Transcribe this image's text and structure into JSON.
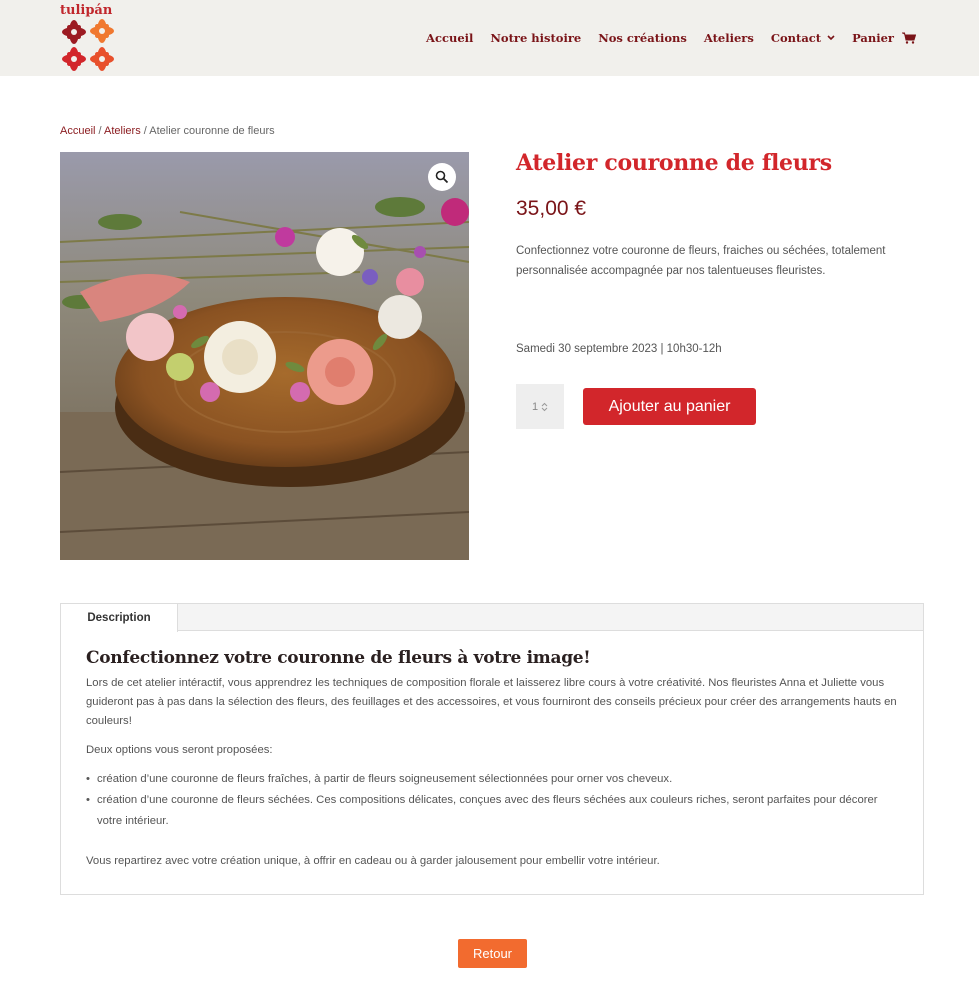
{
  "brand": {
    "logo_text": "tulipán"
  },
  "nav": {
    "items": [
      {
        "label": "Accueil"
      },
      {
        "label": "Notre histoire"
      },
      {
        "label": "Nos créations"
      },
      {
        "label": "Ateliers"
      },
      {
        "label": "Contact"
      },
      {
        "label": "Panier"
      }
    ],
    "contact_chevron": "chevron-down-icon",
    "cart_icon": "cart-icon"
  },
  "breadcrumb": {
    "home": "Accueil",
    "sep1": " / ",
    "category": "Ateliers",
    "sep2": " / ",
    "current": "Atelier couronne de fleurs"
  },
  "product": {
    "title": "Atelier couronne de fleurs",
    "price": "35,00 €",
    "short_description": "Confectionnez votre couronne de fleurs, fraiches ou séchées, totalement personnalisée accompagnée par nos talentueuses fleuristes.",
    "date_line": "Samedi 30 septembre 2023 | 10h30-12h",
    "quantity": "1",
    "add_to_cart_label": "Ajouter au panier"
  },
  "tabs": {
    "active_tab": "Description",
    "heading": "Confectionnez votre couronne de fleurs à votre image!",
    "paragraph1": "Lors de cet atelier intéractif, vous apprendrez les techniques de composition florale et laisserez libre cours à votre créativité. Nos fleuristes Anna et Juliette vous guideront pas à pas dans la sélection des fleurs, des feuillages et des accessoires, et vous fourniront des conseils précieux pour créer des arrangements hauts en couleurs!",
    "paragraph2": "Deux options vous seront proposées:",
    "bullets": [
      "création d’une couronne de fleurs fraîches, à partir de fleurs soigneusement sélectionnées pour orner vos cheveux.",
      "création d’une couronne de fleurs séchées. Ces compositions délicates, conçues avec des fleurs séchées aux couleurs riches, seront parfaites pour décorer votre intérieur."
    ],
    "paragraph3": "Vous repartirez avec votre création unique, à offrir en cadeau ou à garder jalousement pour embellir votre intérieur."
  },
  "footer": {
    "back_label": "Retour"
  },
  "colors": {
    "header_bg": "#f1f0ec",
    "nav_text": "#7a1418",
    "title_red": "#d2262b",
    "button_red": "#d2262b",
    "back_orange": "#f26b2f"
  }
}
